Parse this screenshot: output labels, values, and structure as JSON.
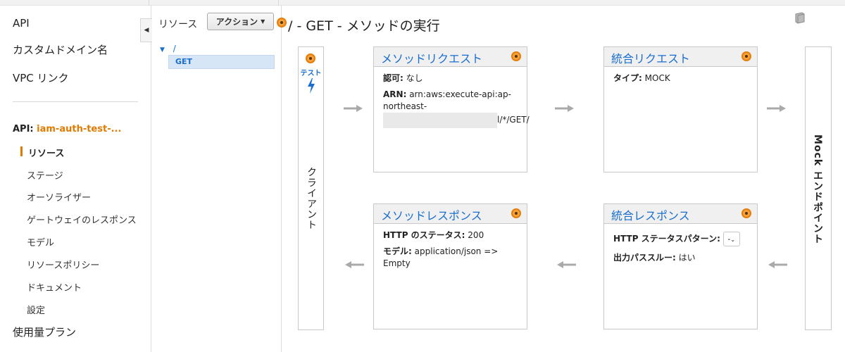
{
  "sidebar": {
    "top_links": [
      "API",
      "カスタムドメイン名",
      "VPC リンク"
    ],
    "api_label": "API:",
    "api_name": "iam-auth-test-...",
    "sub_items": [
      "リソース",
      "ステージ",
      "オーソライザー",
      "ゲートウェイのレスポンス",
      "モデル",
      "リソースポリシー",
      "ドキュメント",
      "設定"
    ],
    "active_sub": "リソース",
    "bottom_link": "使用量プラン"
  },
  "resources": {
    "title": "リソース",
    "action_label": "アクション",
    "tree_root": "/",
    "tree_method": "GET"
  },
  "main": {
    "title": "/ - GET - メソッドの実行",
    "client": {
      "test_label": "テスト",
      "label": "クライアント"
    },
    "mock_label": "Mock エンドポイント",
    "method_request": {
      "title": "メソッドリクエスト",
      "auth_key": "認可:",
      "auth_val": "なし",
      "arn_key": "ARN:",
      "arn_val1": "arn:aws:execute-api:ap-",
      "arn_val2": "northeast-",
      "arn_tail": "l/*/GET/"
    },
    "integration_request": {
      "title": "統合リクエスト",
      "type_key": "タイプ:",
      "type_val": "MOCK"
    },
    "method_response": {
      "title": "メソッドレスポンス",
      "status_key": "HTTP のステータス:",
      "status_val": "200",
      "model_key": "モデル:",
      "model_val": "application/json => Empty"
    },
    "integration_response": {
      "title": "統合レスポンス",
      "pattern_key": "HTTP ステータスパターン:",
      "pattern_val": "-",
      "passthru_key": "出力パススルー:",
      "passthru_val": "はい"
    }
  },
  "colors": {
    "accent_orange": "#e07b00",
    "link_blue": "#1a6ecf",
    "arrow_gray": "#aaaaaa"
  }
}
